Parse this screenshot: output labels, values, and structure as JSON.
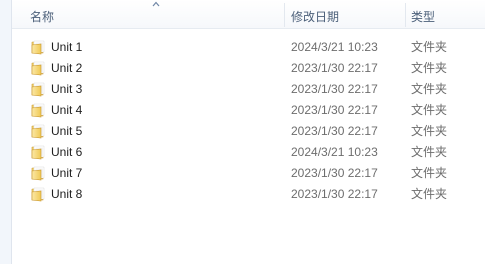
{
  "columns": {
    "name": "名称",
    "date": "修改日期",
    "type": "类型"
  },
  "sort": {
    "column": "name",
    "direction": "ascending"
  },
  "files": [
    {
      "name": "Unit 1",
      "date": "2024/3/21 10:23",
      "type": "文件夹"
    },
    {
      "name": "Unit 2",
      "date": "2023/1/30 22:17",
      "type": "文件夹"
    },
    {
      "name": "Unit 3",
      "date": "2023/1/30 22:17",
      "type": "文件夹"
    },
    {
      "name": "Unit 4",
      "date": "2023/1/30 22:17",
      "type": "文件夹"
    },
    {
      "name": "Unit 5",
      "date": "2023/1/30 22:17",
      "type": "文件夹"
    },
    {
      "name": "Unit 6",
      "date": "2024/3/21 10:23",
      "type": "文件夹"
    },
    {
      "name": "Unit 7",
      "date": "2023/1/30 22:17",
      "type": "文件夹"
    },
    {
      "name": "Unit 8",
      "date": "2023/1/30 22:17",
      "type": "文件夹"
    }
  ]
}
